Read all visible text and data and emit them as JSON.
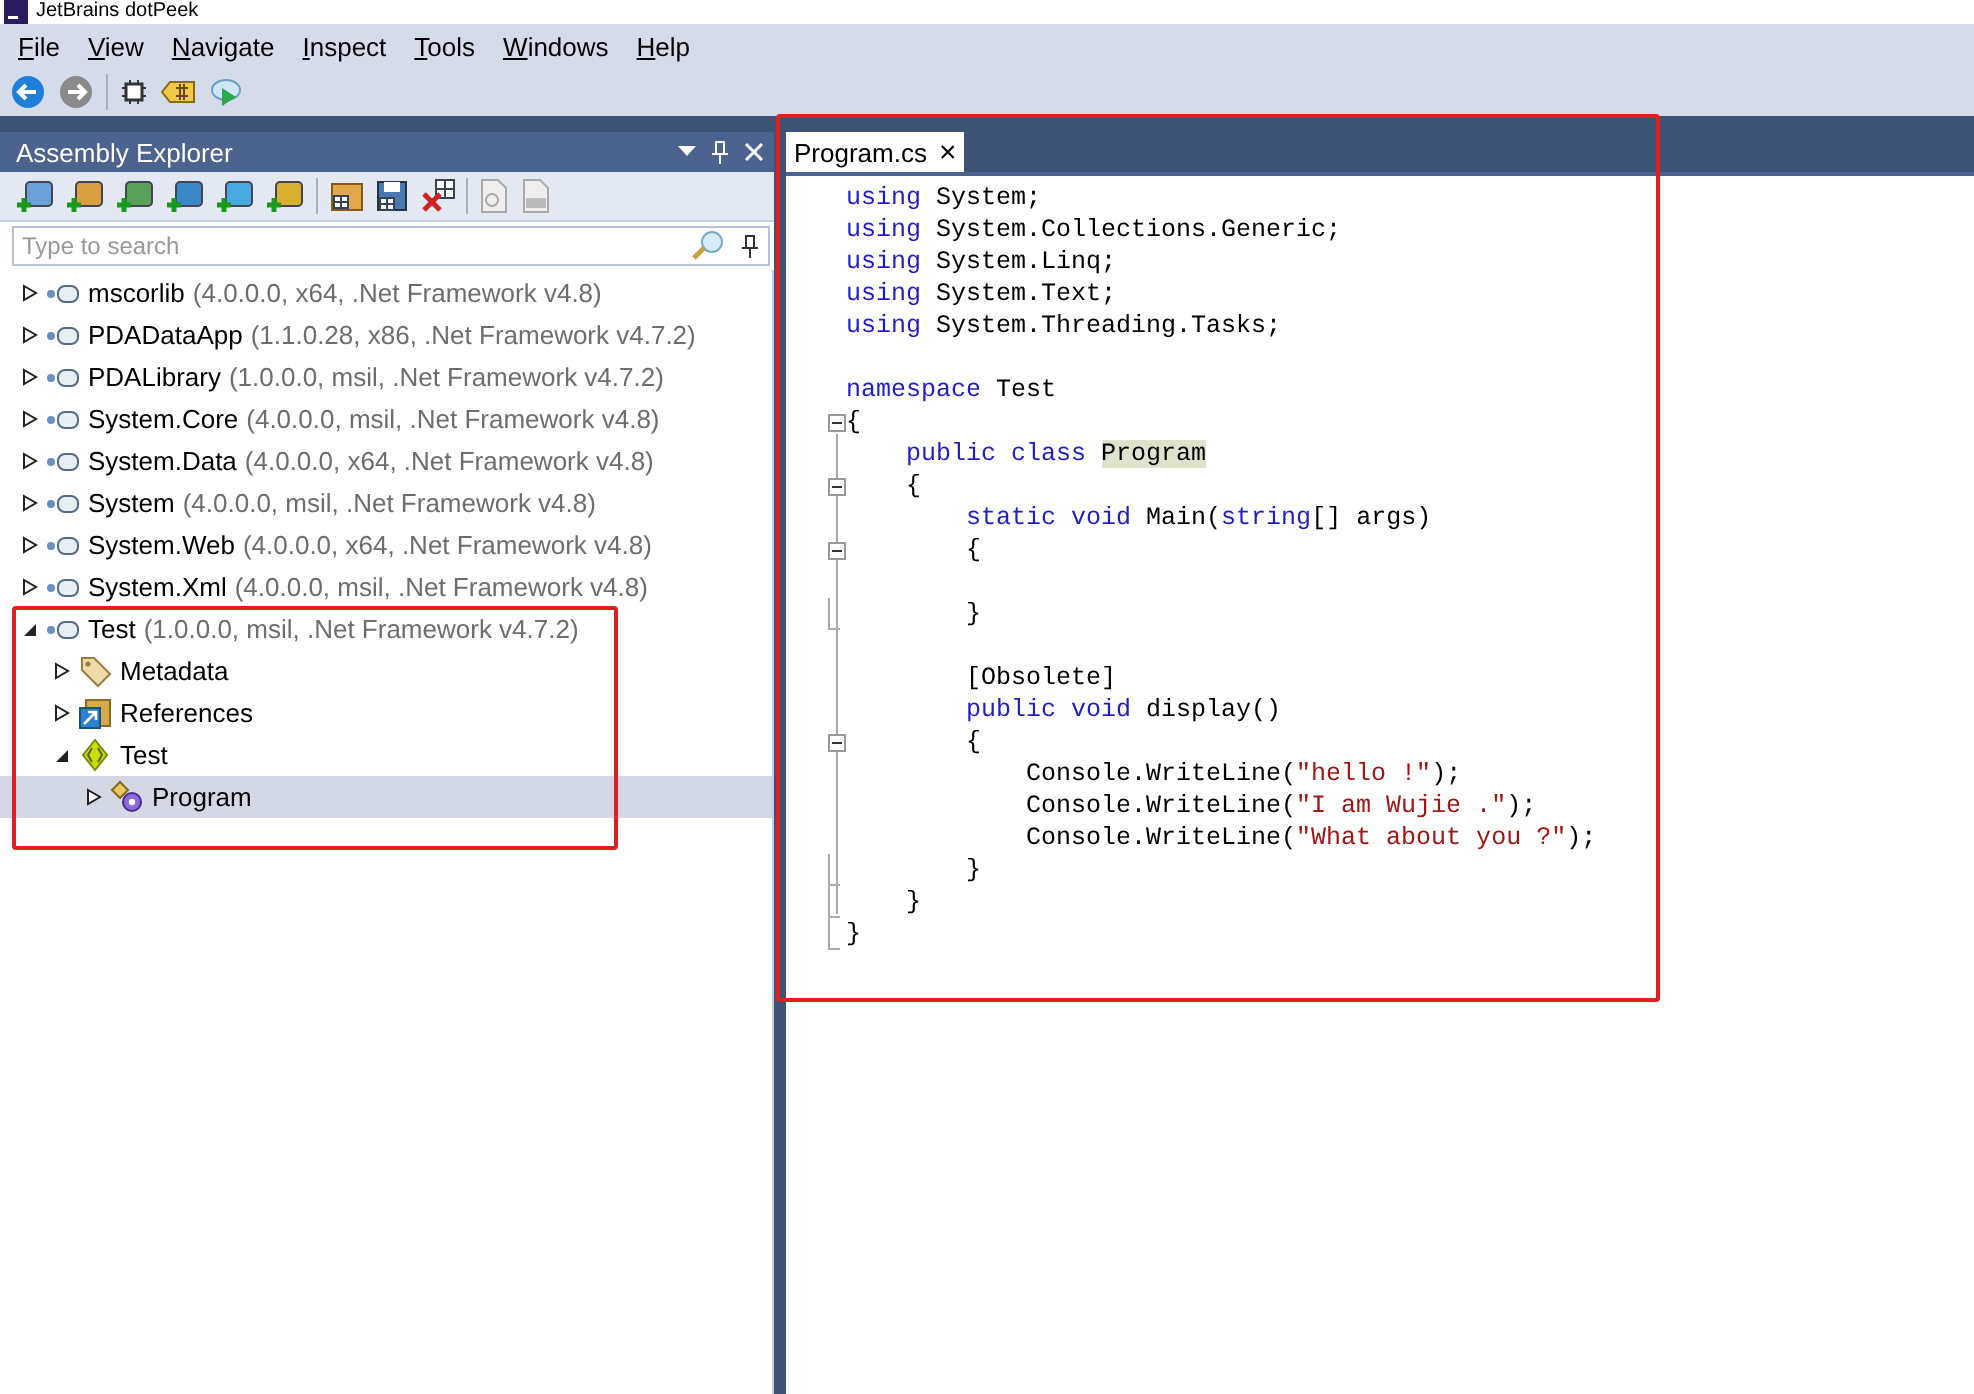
{
  "window": {
    "title": "JetBrains dotPeek"
  },
  "menu": [
    "File",
    "View",
    "Navigate",
    "Inspect",
    "Tools",
    "Windows",
    "Help"
  ],
  "assembly_explorer": {
    "title": "Assembly Explorer",
    "search": {
      "placeholder": "Type to search"
    },
    "tree": [
      {
        "kind": "assembly",
        "name": "mscorlib",
        "detail": "(4.0.0.0, x64, .Net Framework v4.8)",
        "expanded": false,
        "selected": false
      },
      {
        "kind": "assembly",
        "name": "PDADataApp",
        "detail": "(1.1.0.28, x86, .Net Framework v4.7.2)",
        "expanded": false,
        "selected": false
      },
      {
        "kind": "assembly",
        "name": "PDALibrary",
        "detail": "(1.0.0.0, msil, .Net Framework v4.7.2)",
        "expanded": false,
        "selected": false
      },
      {
        "kind": "assembly",
        "name": "System.Core",
        "detail": "(4.0.0.0, msil, .Net Framework v4.8)",
        "expanded": false,
        "selected": false
      },
      {
        "kind": "assembly",
        "name": "System.Data",
        "detail": "(4.0.0.0, x64, .Net Framework v4.8)",
        "expanded": false,
        "selected": false
      },
      {
        "kind": "assembly",
        "name": "System",
        "detail": "(4.0.0.0, msil, .Net Framework v4.8)",
        "expanded": false,
        "selected": false
      },
      {
        "kind": "assembly",
        "name": "System.Web",
        "detail": "(4.0.0.0, x64, .Net Framework v4.8)",
        "expanded": false,
        "selected": false
      },
      {
        "kind": "assembly",
        "name": "System.Xml",
        "detail": "(4.0.0.0, msil, .Net Framework v4.8)",
        "expanded": false,
        "selected": false
      },
      {
        "kind": "assembly",
        "name": "Test",
        "detail": "(1.0.0.0, msil, .Net Framework v4.7.2)",
        "expanded": true,
        "selected": false,
        "children": [
          {
            "kind": "metadata",
            "name": "Metadata",
            "expanded": false,
            "selected": false
          },
          {
            "kind": "references",
            "name": "References",
            "expanded": false,
            "selected": false
          },
          {
            "kind": "namespace",
            "name": "Test",
            "expanded": true,
            "selected": false,
            "children": [
              {
                "kind": "class",
                "name": "Program",
                "expanded": false,
                "selected": true
              }
            ]
          }
        ]
      }
    ]
  },
  "editor": {
    "tabs": [
      {
        "label": "Program.cs",
        "selected": true,
        "close": "×"
      }
    ],
    "lines": [
      {
        "kind": "code",
        "tokens": [
          {
            "kind": "kw",
            "text": "using"
          },
          {
            "kind": "text",
            "text": " System;"
          }
        ]
      },
      {
        "kind": "code",
        "tokens": [
          {
            "kind": "kw",
            "text": "using"
          },
          {
            "kind": "text",
            "text": " System.Collections.Generic;"
          }
        ]
      },
      {
        "kind": "code",
        "tokens": [
          {
            "kind": "kw",
            "text": "using"
          },
          {
            "kind": "text",
            "text": " System.Linq;"
          }
        ]
      },
      {
        "kind": "code",
        "tokens": [
          {
            "kind": "kw",
            "text": "using"
          },
          {
            "kind": "text",
            "text": " System.Text;"
          }
        ]
      },
      {
        "kind": "code",
        "tokens": [
          {
            "kind": "kw",
            "text": "using"
          },
          {
            "kind": "text",
            "text": " System.Threading.Tasks;"
          }
        ]
      },
      {
        "kind": "blank"
      },
      {
        "kind": "code",
        "tokens": [
          {
            "kind": "kw",
            "text": "namespace"
          },
          {
            "kind": "text",
            "text": " Test"
          }
        ]
      },
      {
        "kind": "fold-start",
        "tokens": [
          {
            "kind": "text",
            "text": "{"
          }
        ]
      },
      {
        "kind": "code",
        "tokens": [
          {
            "kind": "kw",
            "text": "    public class "
          },
          {
            "kind": "mark",
            "text": "Program"
          }
        ]
      },
      {
        "kind": "fold-start",
        "tokens": [
          {
            "kind": "text",
            "text": "    {"
          }
        ]
      },
      {
        "kind": "code",
        "tokens": [
          {
            "kind": "kw",
            "text": "        static void"
          },
          {
            "kind": "text",
            "text": " Main("
          },
          {
            "kind": "kw",
            "text": "string"
          },
          {
            "kind": "text",
            "text": "[] args)"
          }
        ]
      },
      {
        "kind": "fold-start",
        "tokens": [
          {
            "kind": "text",
            "text": "        {"
          }
        ]
      },
      {
        "kind": "blank"
      },
      {
        "kind": "fold-end",
        "tokens": [
          {
            "kind": "text",
            "text": "        }"
          }
        ]
      },
      {
        "kind": "blank"
      },
      {
        "kind": "code",
        "tokens": [
          {
            "kind": "text",
            "text": "        [Obsolete]"
          }
        ]
      },
      {
        "kind": "code",
        "tokens": [
          {
            "kind": "kw",
            "text": "        public void"
          },
          {
            "kind": "text",
            "text": " display()"
          }
        ]
      },
      {
        "kind": "fold-start",
        "tokens": [
          {
            "kind": "text",
            "text": "        {"
          }
        ]
      },
      {
        "kind": "code",
        "tokens": [
          {
            "kind": "text",
            "text": "            Console.WriteLine("
          },
          {
            "kind": "str",
            "text": "\"hello !\""
          },
          {
            "kind": "text",
            "text": ");"
          }
        ]
      },
      {
        "kind": "code",
        "tokens": [
          {
            "kind": "text",
            "text": "            Console.WriteLine("
          },
          {
            "kind": "str",
            "text": "\"I am Wujie .\""
          },
          {
            "kind": "text",
            "text": ");"
          }
        ]
      },
      {
        "kind": "code",
        "tokens": [
          {
            "kind": "text",
            "text": "            Console.WriteLine("
          },
          {
            "kind": "str",
            "text": "\"What about you ?\""
          },
          {
            "kind": "text",
            "text": ");"
          }
        ]
      },
      {
        "kind": "fold-end",
        "tokens": [
          {
            "kind": "text",
            "text": "        }"
          }
        ]
      },
      {
        "kind": "fold-end",
        "tokens": [
          {
            "kind": "text",
            "text": "    }"
          }
        ]
      },
      {
        "kind": "fold-end",
        "tokens": [
          {
            "kind": "text",
            "text": "}"
          }
        ]
      }
    ]
  }
}
